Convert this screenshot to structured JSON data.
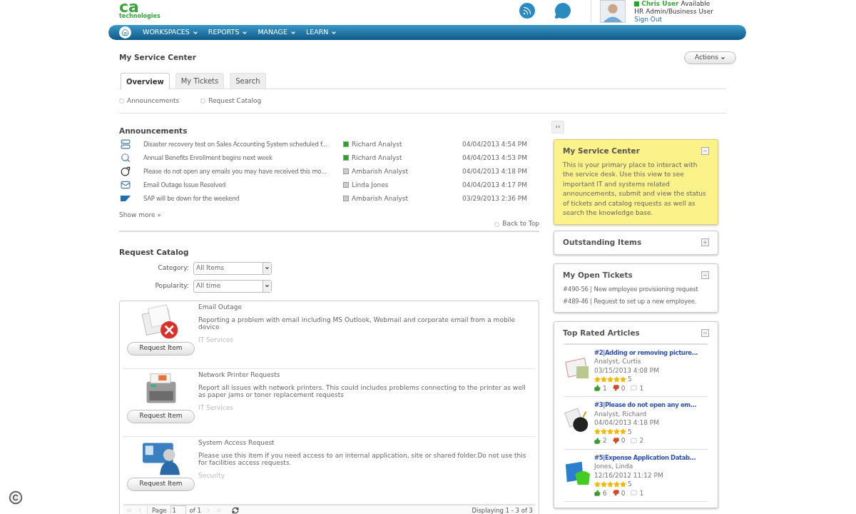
{
  "logo": {
    "mark": "ca",
    "subtitle": "technologies"
  },
  "user": {
    "name": "Chris User",
    "status": "Available",
    "role": "HR Admin/Business User",
    "sign_out": "Sign Out"
  },
  "nav": {
    "items": [
      "WORKSPACES",
      "REPORTS",
      "MANAGE",
      "LEARN"
    ]
  },
  "page_title": "My Service Center",
  "actions_button": "Actions",
  "tabs": [
    {
      "label": "Overview",
      "selected": true
    },
    {
      "label": "My Tickets",
      "selected": false
    },
    {
      "label": "Search",
      "selected": false
    }
  ],
  "section_links": [
    "Announcements",
    "Request Catalog"
  ],
  "announcements": {
    "title": "Announcements",
    "rows": [
      {
        "kind": "server",
        "text": "Disaster recovery test on Sales Accounting System scheduled f...",
        "author": "Richard Analyst",
        "color": "#22aa22",
        "date": "04/04/2013 4:54 PM"
      },
      {
        "kind": "search",
        "text": "Annual Benefits Enrollment begins next week",
        "author": "Richard Analyst",
        "color": "#22aa22",
        "date": "04/04/2013 4:53 PM"
      },
      {
        "kind": "bomb",
        "text": "Please do not open any emails you may have received this mo...",
        "author": "Ambarish Analyst",
        "color": "#cccccc",
        "date": "04/04/2013 4:18 PM"
      },
      {
        "kind": "mail",
        "text": "Email Outage Issue Resolved",
        "author": "Linda Jones",
        "color": "#cccccc",
        "date": "04/04/2013 4:17 PM"
      },
      {
        "kind": "logo",
        "text": "SAP will be down for the weekend",
        "author": "Ambarish Analyst",
        "color": "#cccccc",
        "date": "03/29/2013 2:36 PM"
      }
    ],
    "show_more": "Show more »",
    "back_to_top": "Back to Top"
  },
  "catalog": {
    "title": "Request Catalog",
    "filters": [
      {
        "label": "Category:",
        "value": "All Items"
      },
      {
        "label": "Popularity:",
        "value": "All time"
      }
    ],
    "items": [
      {
        "kind": "email",
        "name": "Email Outage",
        "description": "Reporting a problem with email including MS Outlook, Webmail and corporate email from a mobile device",
        "category": "IT Services",
        "button": "Request Item"
      },
      {
        "kind": "printer",
        "name": "Network Printer Requests",
        "description": "Report all issues with network printers. This could includes problems connecting to the printer as well as paper jams or toner replacement requests",
        "category": "IT Services",
        "button": "Request Item"
      },
      {
        "kind": "access",
        "name": "System Access Request",
        "description": "Please use this item if you need access to an internal application, site or shared folder.Do not use this for facilities access requests.",
        "category": "Security",
        "button": "Request Item"
      }
    ],
    "pager": {
      "page_label": "Page",
      "page": "1",
      "of": "of 1",
      "displaying": "Displaying 1 - 3 of 3"
    }
  },
  "sidebar": {
    "toggle": "››",
    "panels": [
      {
        "kind": "info",
        "title": "My Service Center",
        "expanded": true,
        "text": "This is your primary place to interact with the service desk. Use this view to see important IT and systems related announcements, submit and view the status of tickets and catalog requests as well as search the knowledge base."
      },
      {
        "kind": "empty",
        "title": "Outstanding Items",
        "expanded": false
      },
      {
        "kind": "tickets",
        "title": "My Open Tickets",
        "expanded": true,
        "tickets": [
          "#490-56 | New employee provisioning request",
          "#489-46 | Request to set up a new employee."
        ]
      },
      {
        "kind": "articles",
        "title": "Top Rated Articles",
        "expanded": true,
        "articles": [
          {
            "kind": "email",
            "title": "#2|Adding or removing picture...",
            "author": "Analyst, Curtis",
            "date": "03/15/2013 4:08 PM",
            "stars": 5,
            "rating": "5",
            "likes": "1",
            "dislikes": "0",
            "comments": "1"
          },
          {
            "kind": "bomb",
            "title": "#3|Please do not open any em...",
            "author": "Analyst, Richard",
            "date": "04/04/2013 4:18 PM",
            "stars": 5,
            "rating": "5",
            "likes": "2",
            "dislikes": "0",
            "comments": "2"
          },
          {
            "kind": "map",
            "title": "#5|Expense Application Datab...",
            "author": "Jones, Linda",
            "date": "12/16/2012 11:12 PM",
            "stars": 5,
            "rating": "5",
            "likes": "6",
            "dislikes": "0",
            "comments": "1"
          }
        ]
      }
    ]
  }
}
